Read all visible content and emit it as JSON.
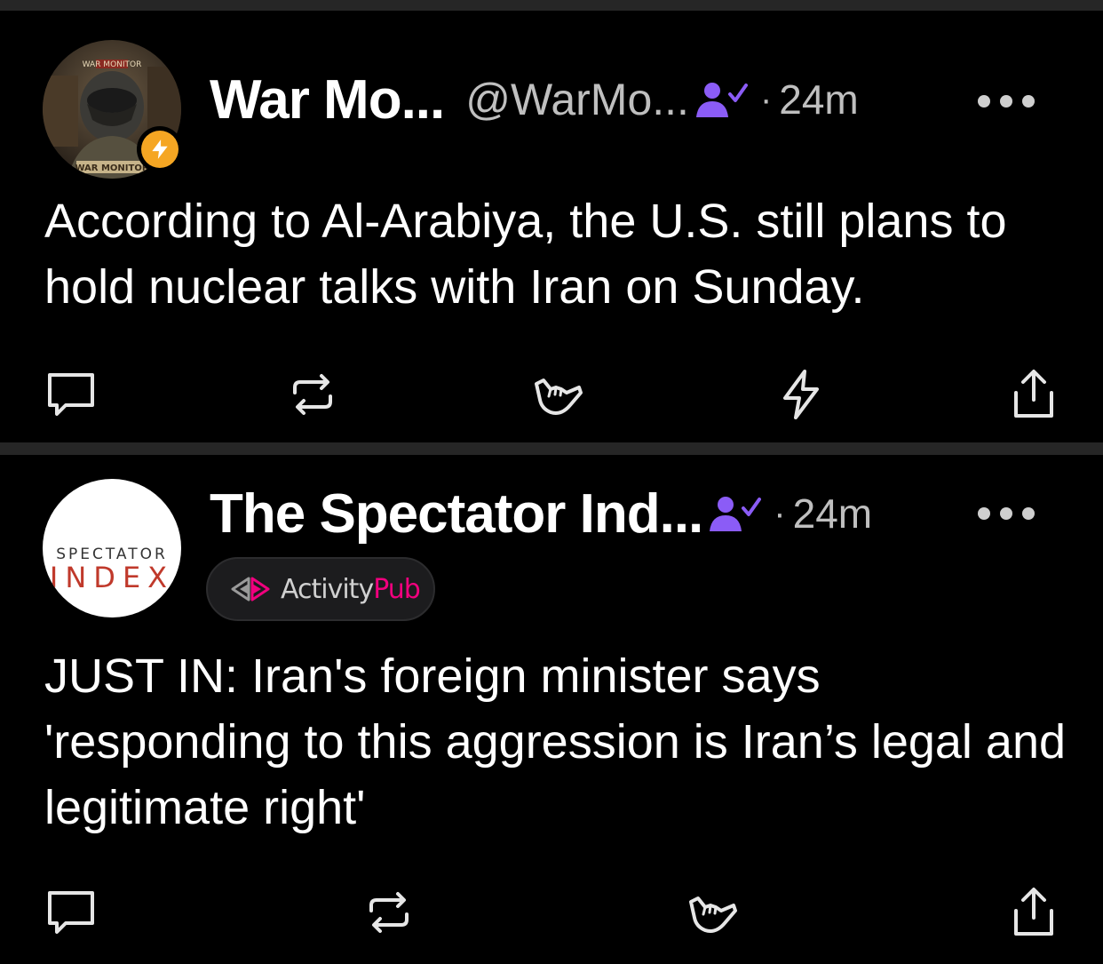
{
  "posts": [
    {
      "display_name": "War Mo...",
      "handle": "@WarMo...",
      "dot": "·",
      "time": "24m",
      "avatar_text": "WAR MONITOR",
      "text": "According to Al-Arabiya, the U.S. still plans to hold nuclear talks with Iran on Sunday.",
      "badge_icon": "lightning-bolt-icon"
    },
    {
      "display_name": "The Spectator Ind...",
      "dot": "·",
      "time": "24m",
      "avatar_line1": "SPECTATOR",
      "avatar_line2": "INDEX",
      "protocol_prefix": "Activity",
      "protocol_suffix": "Pub",
      "text": "JUST IN: Iran's foreign minister says 'responding to this aggression is Iran’s legal and legitimate right'"
    }
  ],
  "actions": [
    "reply-icon",
    "repost-icon",
    "shaka-like-icon",
    "zap-icon",
    "share-icon"
  ],
  "colors": {
    "background": "#000000",
    "separator": "#262626",
    "muted": "#bfbfbf",
    "verified": "#8b5cf6",
    "zap_badge": "#f5a623",
    "activitypub_pink": "#f1007e"
  }
}
